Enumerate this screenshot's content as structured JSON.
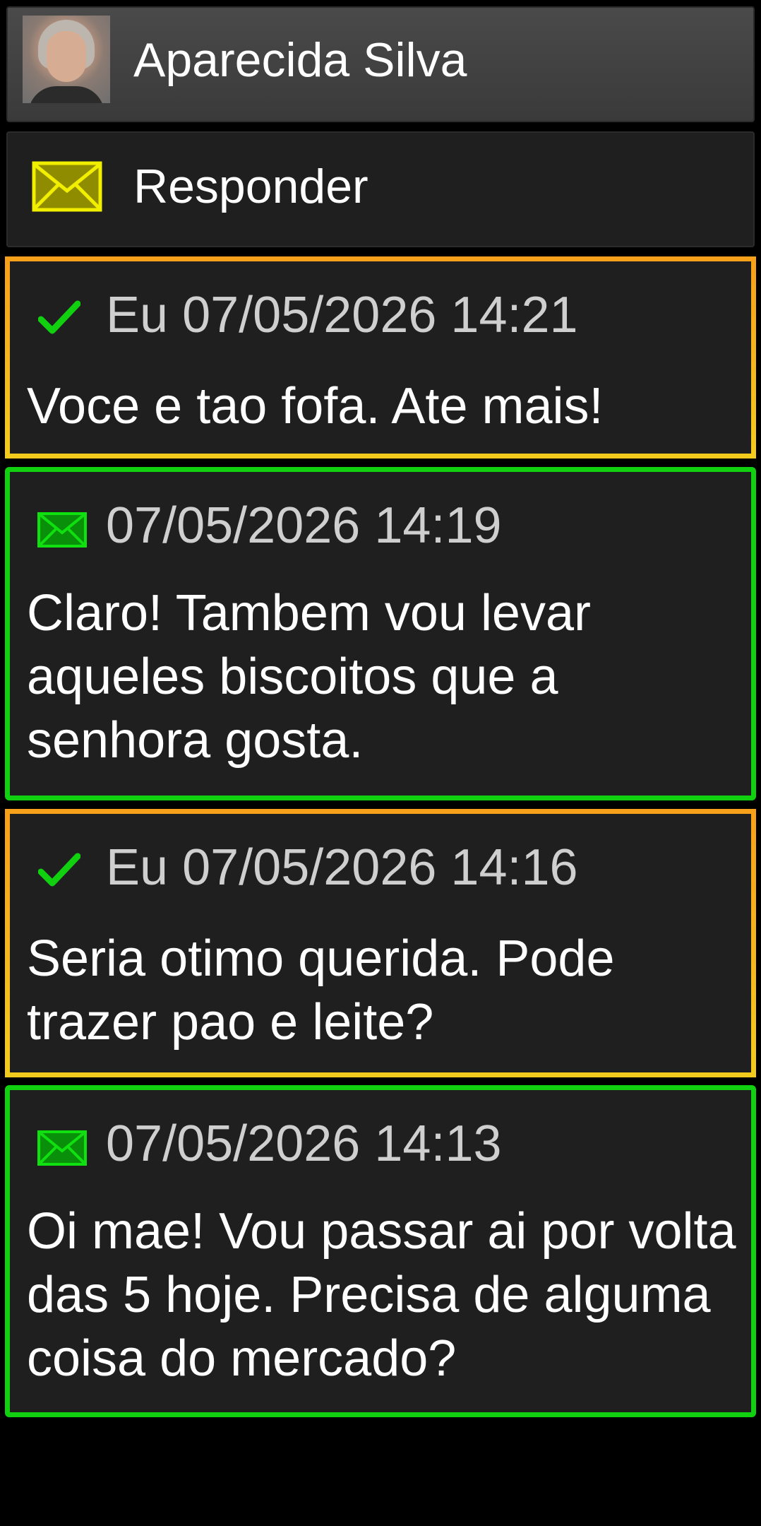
{
  "header": {
    "contact_name": "Aparecida Silva",
    "avatar_icon": "contact-photo"
  },
  "reply": {
    "label": "Responder",
    "icon": "envelope-icon",
    "icon_color": "#e6e000"
  },
  "colors": {
    "sent_border": "#f4a31f",
    "received_border": "#10d010",
    "sent_check": "#10d010",
    "received_envelope": "#10d010"
  },
  "messages": [
    {
      "direction": "sent",
      "status_icon": "check-icon",
      "meta": "Eu 07/05/2026 14:21",
      "text": "Voce e tao fofa. Ate mais!"
    },
    {
      "direction": "received",
      "status_icon": "envelope-icon",
      "meta": "07/05/2026 14:19",
      "text": "Claro! Tambem vou levar aqueles biscoitos que a senhora gosta."
    },
    {
      "direction": "sent",
      "status_icon": "check-icon",
      "meta": "Eu 07/05/2026 14:16",
      "text": "Seria otimo querida. Pode trazer pao e leite?"
    },
    {
      "direction": "received",
      "status_icon": "envelope-icon",
      "meta": "07/05/2026 14:13",
      "text": "Oi mae! Vou passar ai por volta das 5 hoje. Precisa de alguma coisa do mercado?"
    }
  ]
}
